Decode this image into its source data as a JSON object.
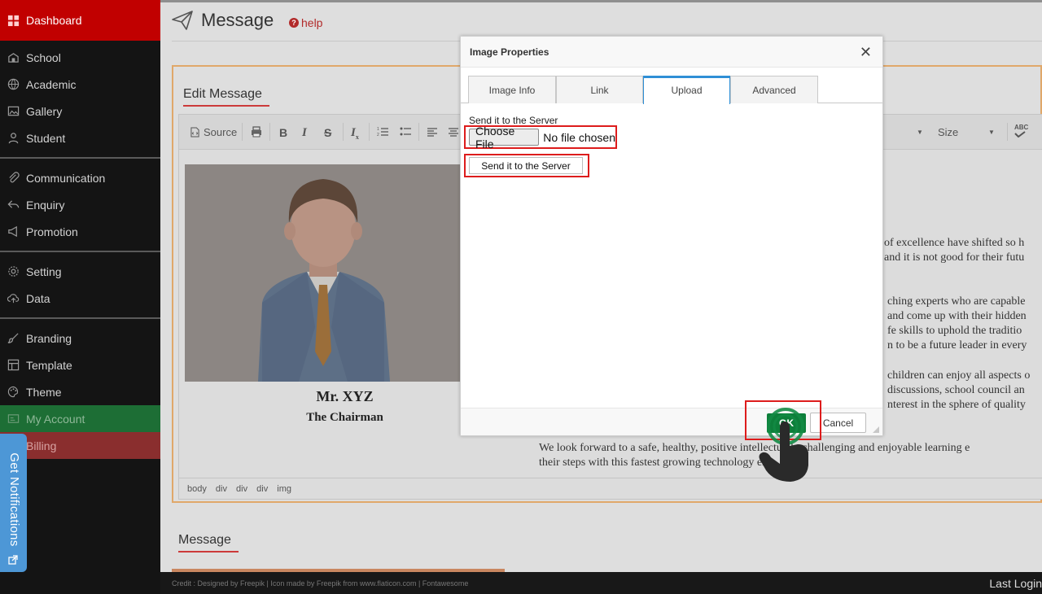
{
  "sidebar": {
    "dashboard": "Dashboard",
    "items": [
      {
        "label": "School",
        "icon": "school-icon"
      },
      {
        "label": "Academic",
        "icon": "globe-icon"
      },
      {
        "label": "Gallery",
        "icon": "image-icon"
      },
      {
        "label": "Student",
        "icon": "user-icon"
      },
      {
        "label": "Communication",
        "icon": "paperclip-icon"
      },
      {
        "label": "Enquiry",
        "icon": "reply-icon"
      },
      {
        "label": "Promotion",
        "icon": "megaphone-icon"
      },
      {
        "label": "Setting",
        "icon": "gear-icon"
      },
      {
        "label": "Data",
        "icon": "cloud-upload-icon"
      },
      {
        "label": "Branding",
        "icon": "brush-icon"
      },
      {
        "label": "Template",
        "icon": "template-icon"
      },
      {
        "label": "Theme",
        "icon": "palette-icon"
      }
    ],
    "my_account": "My Account",
    "billing": "Billing",
    "notifications": "Get Notifications"
  },
  "page": {
    "title": "Message",
    "help": "help",
    "edit_title": "Edit Message",
    "section2_title": "Message"
  },
  "editor": {
    "source_label": "Source",
    "size_label": "Size",
    "spell_label": "ABC",
    "photo_name": "Mr. XYZ",
    "photo_role": "The Chairman",
    "lines": [
      "of excellence have shifted so h",
      "and it is not good for their futu",
      "ching experts who are capable",
      "and come up with their hidden",
      "fe skills to uphold the traditio",
      "n to be a future leader in every",
      "children can enjoy all aspects o",
      "discussions, school council an",
      "nterest in the sphere of quality",
      "We look forward to a safe, healthy, positive intellectually challenging and enjoyable learning e",
      "their steps with this fastest growing technology era."
    ],
    "path": [
      "body",
      "div",
      "div",
      "div",
      "img"
    ]
  },
  "dialog": {
    "title": "Image Properties",
    "tabs": [
      "Image Info",
      "Link",
      "Upload",
      "Advanced"
    ],
    "active_tab": "Upload",
    "upload_label": "Send it to the Server",
    "choose_file": "Choose File",
    "file_status": "No file chosen",
    "send_button": "Send it to the Server",
    "ok": "OK",
    "cancel": "Cancel"
  },
  "footer": {
    "credit": "Credit : Designed by Freepik | Icon made by Freepik from www.flaticon.com | Fontawesome",
    "last_login": "Last Login"
  },
  "colors": {
    "dashboard_bg": "#c10000",
    "my_account_bg": "#1d6e35",
    "billing_bg": "#8a2e2e",
    "accent_red": "#dd1c1c",
    "ok_green": "#0d7f3a",
    "tab_active_border": "#2f8fd6"
  }
}
